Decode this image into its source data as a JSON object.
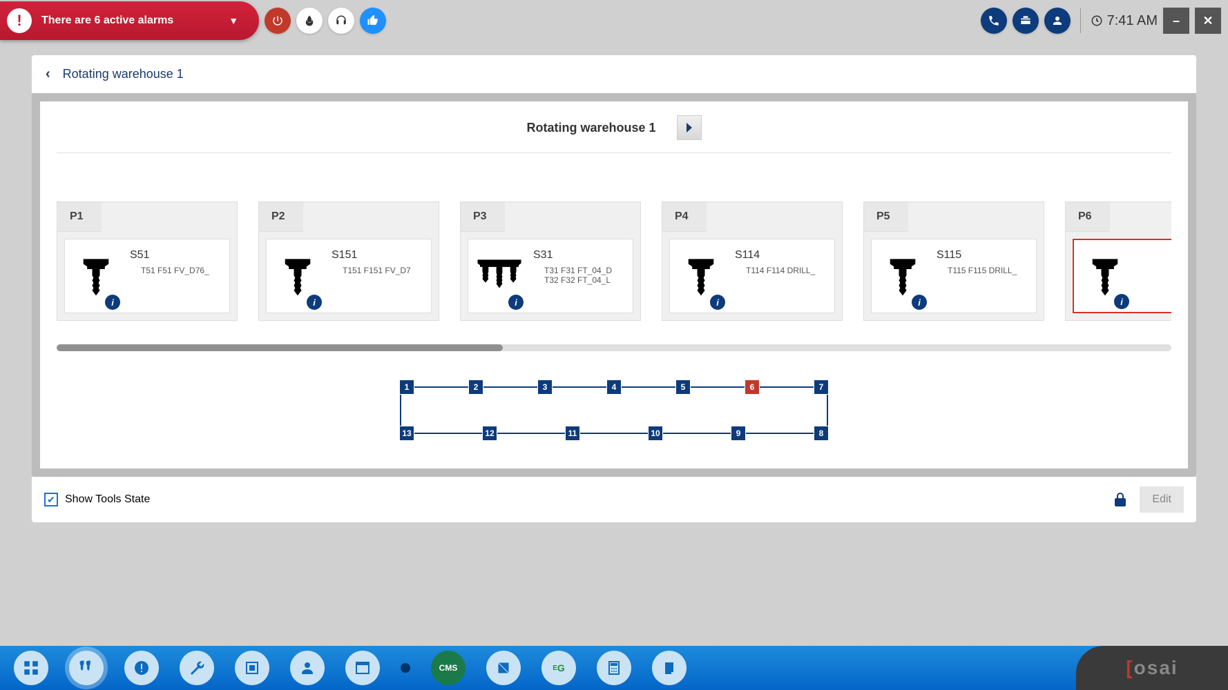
{
  "alarm": {
    "text": "There are 6 active alarms"
  },
  "clock": {
    "time": "7:41 AM"
  },
  "breadcrumb": {
    "title": "Rotating warehouse 1"
  },
  "warehouse": {
    "title": "Rotating warehouse 1"
  },
  "slots": [
    {
      "pos": "P1",
      "name": "S51",
      "lines": [
        "T51 F51 FV_D76_"
      ],
      "multi": false,
      "error": false
    },
    {
      "pos": "P2",
      "name": "S151",
      "lines": [
        "T151 F151 FV_D7"
      ],
      "multi": false,
      "error": false
    },
    {
      "pos": "P3",
      "name": "S31",
      "lines": [
        "T31 F31 FT_04_D",
        "T32 F32 FT_04_L"
      ],
      "multi": true,
      "error": false
    },
    {
      "pos": "P4",
      "name": "S114",
      "lines": [
        "T114 F114 DRILL_"
      ],
      "multi": false,
      "error": false
    },
    {
      "pos": "P5",
      "name": "S115",
      "lines": [
        "T115 F115 DRILL_"
      ],
      "multi": false,
      "error": false
    },
    {
      "pos": "P6",
      "name": "",
      "lines": [],
      "multi": false,
      "error": true
    }
  ],
  "diagram": {
    "top": [
      "1",
      "2",
      "3",
      "4",
      "5",
      "6",
      "7"
    ],
    "bottom": [
      "13",
      "12",
      "11",
      "10",
      "9",
      "8"
    ],
    "errorNode": "6"
  },
  "footer": {
    "showToolsState": "Show Tools State",
    "edit": "Edit"
  },
  "brand": {
    "text": "osai"
  }
}
